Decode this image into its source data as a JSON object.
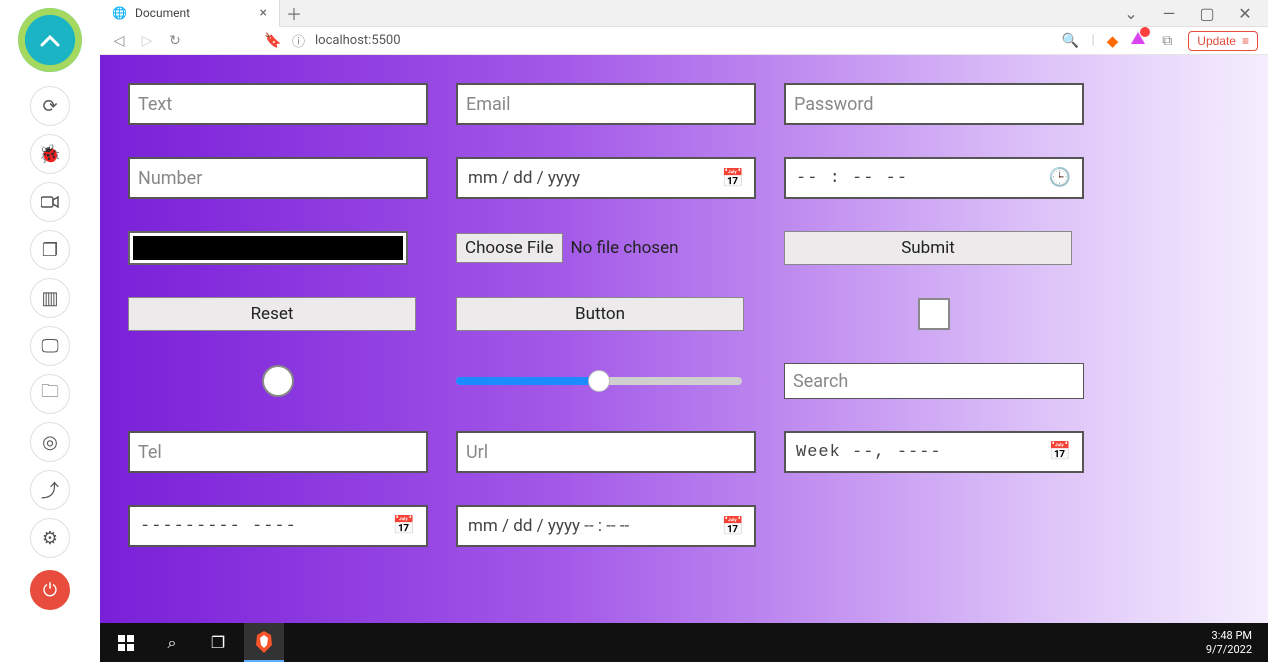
{
  "sidebar": {
    "icons": [
      "sync",
      "bug",
      "camera",
      "copy",
      "chip",
      "monitor",
      "folder",
      "location",
      "upload",
      "gear",
      "power"
    ]
  },
  "browser": {
    "tab_title": "Document",
    "url": "localhost:5500",
    "update_label": "Update"
  },
  "form": {
    "text_placeholder": "Text",
    "email_placeholder": "Email",
    "password_placeholder": "Password",
    "number_placeholder": "Number",
    "date_placeholder": "mm / dd / yyyy",
    "time_placeholder": "-- : --  --",
    "color_value": "#000000",
    "file_choose_label": "Choose File",
    "file_status": "No file chosen",
    "submit_label": "Submit",
    "reset_label": "Reset",
    "button_label": "Button",
    "range_value": 50,
    "search_placeholder": "Search",
    "tel_placeholder": "Tel",
    "url_placeholder": "Url",
    "week_placeholder": "Week  --,  ----",
    "month_placeholder": "---------  ----",
    "datetime_placeholder": "mm / dd / yyyy  -- : --  --"
  },
  "taskbar": {
    "time": "3:48 PM",
    "date": "9/7/2022"
  }
}
